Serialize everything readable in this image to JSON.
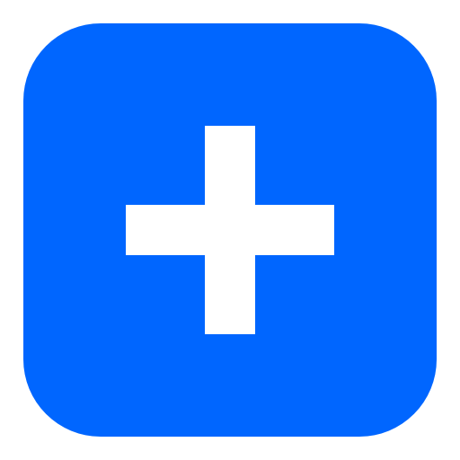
{
  "add_button": {
    "icon": "plus-icon",
    "background_color": "#0066FF",
    "icon_color": "#FFFFFF"
  }
}
